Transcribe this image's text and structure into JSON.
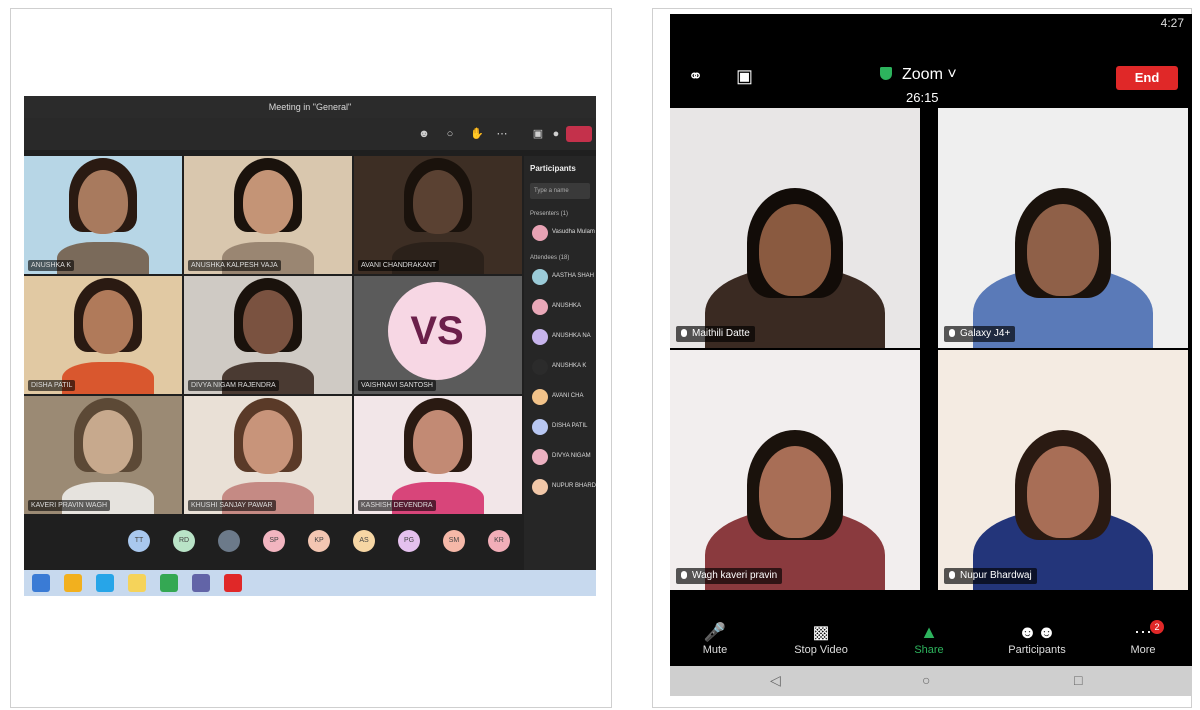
{
  "left": {
    "window_title": "Meeting in \"General\"",
    "participants_title": "Participants",
    "search_placeholder": "Type a name",
    "presenters_label": "Presenters (1)",
    "attendees_label": "Attendees (18)",
    "vs_initials": "VS",
    "presenter": {
      "name": "Vasudha Mulam",
      "sub": "Organizer",
      "color": "#e7a2b4"
    },
    "attendees": [
      {
        "name": "AASTHA SHAH",
        "color": "#9bcbd8"
      },
      {
        "name": "ANUSHKA",
        "color": "#e9a8b8"
      },
      {
        "name": "ANUSHKA NA",
        "color": "#c7b4ec"
      },
      {
        "name": "ANUSHKA K",
        "color": "#2b2b2b"
      },
      {
        "name": "AVANI CHA",
        "color": "#f2c38a"
      },
      {
        "name": "DISHA PATIL",
        "color": "#b8c7f2"
      },
      {
        "name": "DIVYA NIGAM",
        "color": "#ecb1c1"
      },
      {
        "name": "NUPUR BHARDWAJ",
        "color": "#f1c7a8"
      }
    ],
    "tiles": [
      {
        "name": "ANUSHKA K",
        "bg": "#b7d6e6",
        "skin": "#a87a5e",
        "hair": "#2a1a12",
        "cloth": "#7a6a5a"
      },
      {
        "name": "ANUSHKA KALPESH VAJA",
        "bg": "#d9c7ae",
        "skin": "#c49476",
        "hair": "#1a120c",
        "cloth": "#9a8672"
      },
      {
        "name": "AVANI CHANDRAKANT",
        "bg": "#3d2e24",
        "skin": "#5a4132",
        "hair": "#1a120c",
        "cloth": "#2b211a"
      },
      {
        "name": "DISHA PATIL",
        "bg": "#e1c9a3",
        "skin": "#b07a5a",
        "hair": "#2a1a12",
        "cloth": "#d9572e"
      },
      {
        "name": "DIVYA NIGAM RAJENDRA",
        "bg": "#cfcac4",
        "skin": "#7a5240",
        "hair": "#1a120c",
        "cloth": "#4a3a32"
      },
      {
        "name": "VAISHNAVI SANTOSH",
        "bg": "#5b5b5b",
        "skin": "",
        "hair": "",
        "cloth": ""
      },
      {
        "name": "KAVERI PRAVIN WAGH",
        "bg": "#9b8a74",
        "skin": "#c7a98d",
        "hair": "#5c4936",
        "cloth": "#e6e3de"
      },
      {
        "name": "KHUSHI SANJAY PAWAR",
        "bg": "#e9e0d6",
        "skin": "#c8947a",
        "hair": "#5a3a28",
        "cloth": "#c58a84"
      },
      {
        "name": "KASHISH DEVENDRA",
        "bg": "#f2e6e8",
        "skin": "#c28a74",
        "hair": "#2a1a12",
        "cloth": "#d8457a"
      }
    ],
    "strip": [
      {
        "label": "TT",
        "color": "#a9c8ee"
      },
      {
        "label": "RD",
        "color": "#b9e3c7"
      },
      {
        "label": "",
        "color": "#6c7a8a"
      },
      {
        "label": "SP",
        "color": "#f2b5c0"
      },
      {
        "label": "KP",
        "color": "#f3c6b2"
      },
      {
        "label": "AS",
        "color": "#f6d6a4"
      },
      {
        "label": "PG",
        "color": "#e5c1ee"
      },
      {
        "label": "SM",
        "color": "#f5b8a8"
      },
      {
        "label": "KR",
        "color": "#f2aeb8"
      }
    ],
    "taskbar_icons": [
      "#3a7bd5",
      "#f2b01e",
      "#27a5e8",
      "#f5d35a",
      "#34a853",
      "#6264a7",
      "#e02828"
    ]
  },
  "right": {
    "time": "4:27",
    "app_title": "Zoom",
    "timer": "26:15",
    "end_label": "End",
    "tiles": [
      {
        "name": "Maithili Datte",
        "bg": "#e8e6e6",
        "skin": "#8a5a40",
        "hair": "#120c08",
        "cloth": "#3a2a22"
      },
      {
        "name": "Galaxy J4+",
        "bg": "#efefef",
        "skin": "#8f6048",
        "hair": "#1a120c",
        "cloth": "#5a7ab8"
      },
      {
        "name": "Wagh kaveri pravin",
        "bg": "#f2eeee",
        "skin": "#a86e56",
        "hair": "#1a120c",
        "cloth": "#8a3a3e"
      },
      {
        "name": "Nupur Bhardwaj",
        "bg": "#f4ebe2",
        "skin": "#a86e56",
        "hair": "#2a1a12",
        "cloth": "#23357a"
      }
    ],
    "controls": {
      "mute": "Mute",
      "stop_video": "Stop Video",
      "share": "Share",
      "participants": "Participants",
      "more": "More",
      "more_badge": "2"
    }
  }
}
